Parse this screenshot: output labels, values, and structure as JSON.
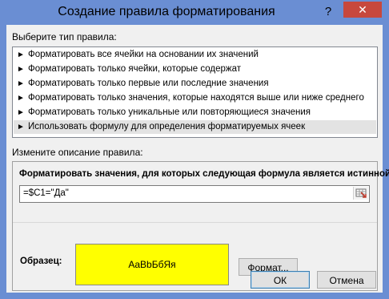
{
  "window": {
    "title": "Создание правила форматирования",
    "help_label": "?",
    "close_label": "✕"
  },
  "rule_type": {
    "label": "Выберите тип правила:",
    "items": [
      {
        "label": "Форматировать все ячейки на основании их значений",
        "selected": false
      },
      {
        "label": "Форматировать только ячейки, которые содержат",
        "selected": false
      },
      {
        "label": "Форматировать только первые или последние значения",
        "selected": false
      },
      {
        "label": "Форматировать только значения, которые находятся выше или ниже среднего",
        "selected": false
      },
      {
        "label": "Форматировать только уникальные или повторяющиеся значения",
        "selected": false
      },
      {
        "label": "Использовать формулу для определения форматируемых ячеек",
        "selected": true
      }
    ],
    "bullet": "►"
  },
  "description": {
    "label": "Измените описание правила:",
    "formula_label": "Форматировать значения, для которых следующая формула является истинной:",
    "formula_value": "=$C1=\"Да\"",
    "preview_label": "Образец:",
    "preview_text": "AaBbБбЯя",
    "preview_fill": "#ffff00",
    "format_button": "Формат..."
  },
  "buttons": {
    "ok": "ОК",
    "cancel": "Отмена"
  },
  "colors": {
    "titlebar": "#6a8ed3",
    "close": "#c7483d",
    "selected_row": "#e3e3e3"
  }
}
